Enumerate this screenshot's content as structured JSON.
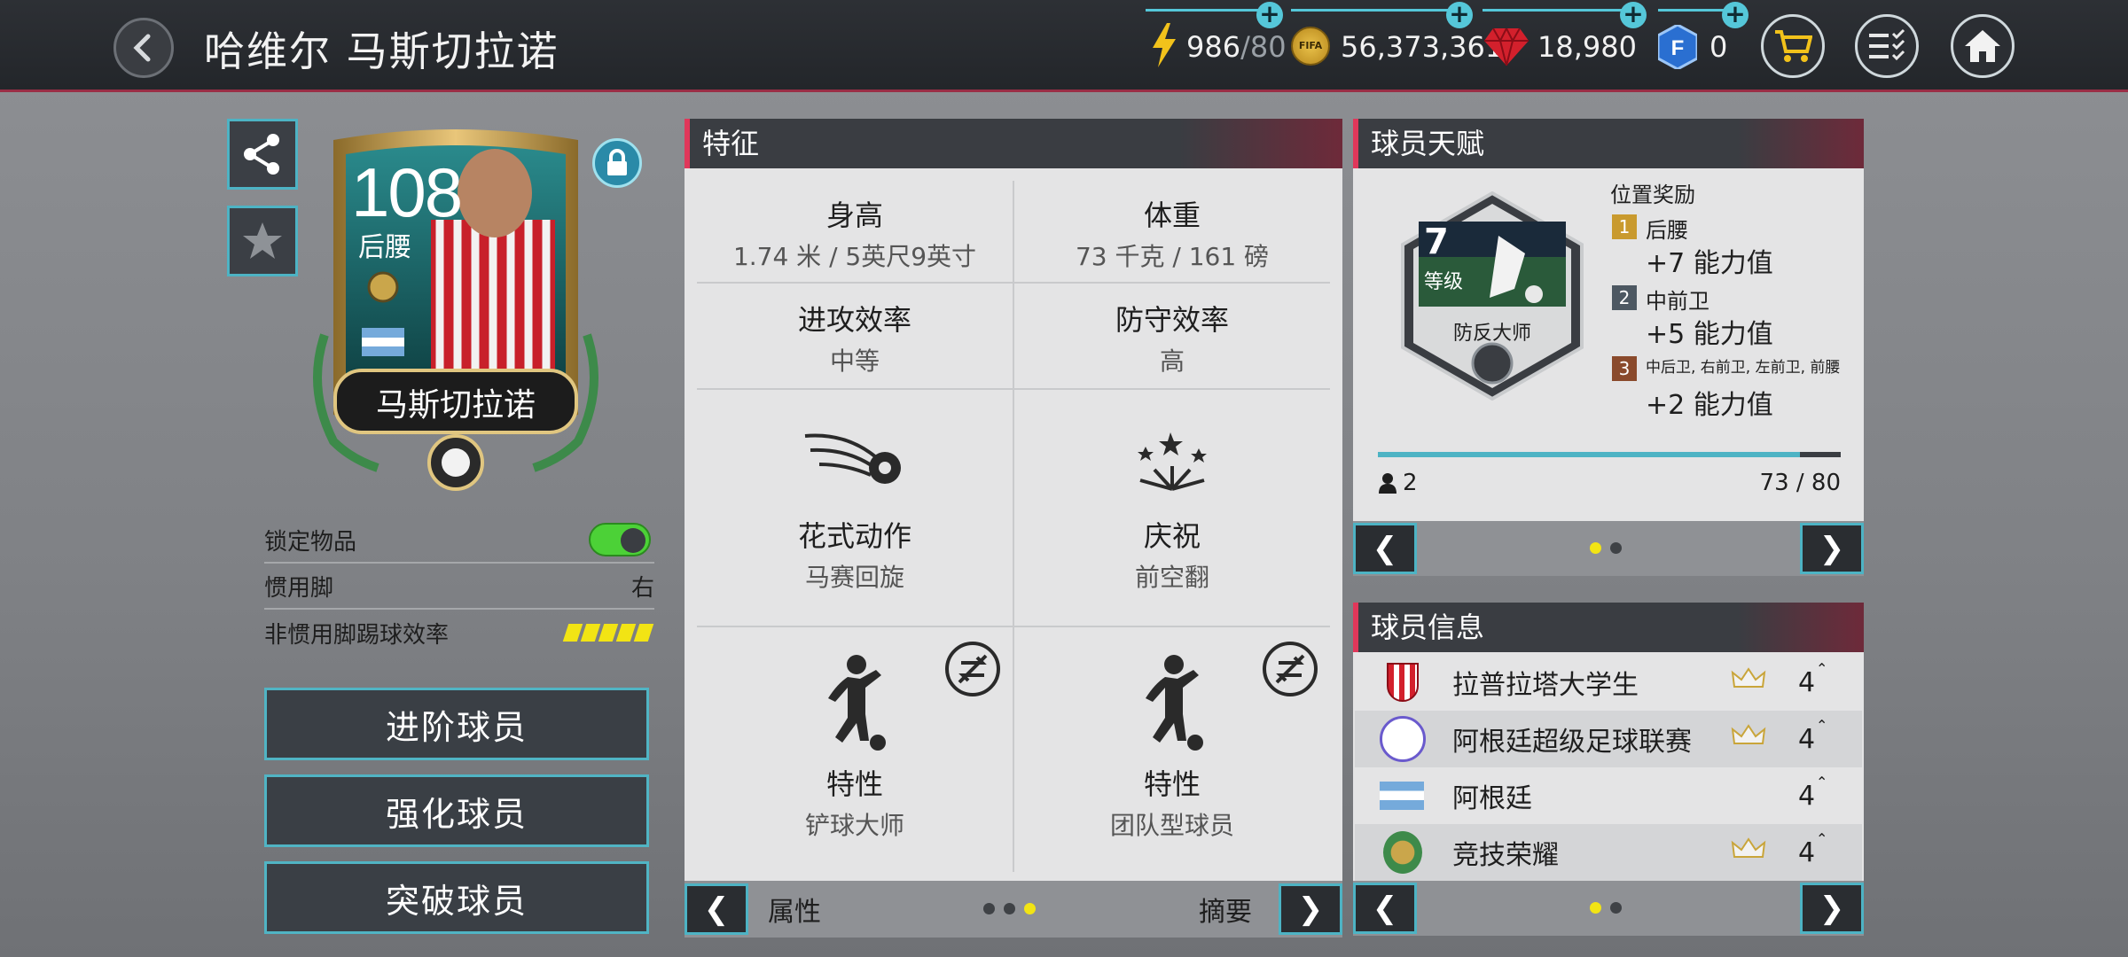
{
  "header": {
    "title": "哈维尔 马斯切拉诺",
    "energy": {
      "value": "986",
      "max": "/80"
    },
    "coins": "56,373,361",
    "gems": "18,980",
    "fifa_points": "0",
    "coin_label": "FIFA"
  },
  "card": {
    "rating": "108",
    "position": "后腰",
    "name": "马斯切拉诺"
  },
  "left_info": {
    "lock_label": "锁定物品",
    "lock_on": true,
    "preferred_foot_label": "惯用脚",
    "preferred_foot_value": "右",
    "weak_foot_label": "非惯用脚踢球效率",
    "weak_foot_stars": 5
  },
  "buttons": {
    "advance": "进阶球员",
    "train": "强化球员",
    "breakthrough": "突破球员"
  },
  "traits_panel": {
    "title": "特征",
    "height_label": "身高",
    "height_value": "1.74 米 / 5英尺9英寸",
    "weight_label": "体重",
    "weight_value": "73 千克 / 161 磅",
    "att_rate_label": "进攻效率",
    "att_rate_value": "中等",
    "def_rate_label": "防守效率",
    "def_rate_value": "高",
    "skill_label": "花式动作",
    "skill_value": "马赛回旋",
    "celebration_label": "庆祝",
    "celebration_value": "前空翻",
    "trait1_label": "特性",
    "trait1_value": "铲球大师",
    "trait2_label": "特性",
    "trait2_value": "团队型球员",
    "nav_left": "属性",
    "nav_right": "摘要",
    "page_index": 2,
    "page_count": 3
  },
  "skill_panel": {
    "title": "球员天赋",
    "level": "7",
    "level_label": "等级",
    "skill_name": "防反大师",
    "bonus_title": "位置奖励",
    "bonuses": [
      {
        "rank": "1",
        "pos": "后腰",
        "value": "+7 能力值",
        "color": "#c99a2e"
      },
      {
        "rank": "2",
        "pos": "中前卫",
        "value": "+5 能力值",
        "color": "#4d5862"
      },
      {
        "rank": "3",
        "pos": "中后卫, 右前卫, 左前卫, 前腰",
        "value": "+2 能力值",
        "color": "#8a4a2c"
      }
    ],
    "points": "2",
    "progress": "73 / 80",
    "progress_fraction": 0.9125,
    "page_index": 0,
    "page_count": 2
  },
  "player_info": {
    "title": "球员信息",
    "rows": [
      {
        "name": "拉普拉塔大学生",
        "value": "4",
        "crown": true
      },
      {
        "name": "阿根廷超级足球联赛",
        "value": "4",
        "crown": true
      },
      {
        "name": "阿根廷",
        "value": "4",
        "crown": false
      },
      {
        "name": "竞技荣耀",
        "value": "4",
        "crown": true
      }
    ],
    "page_index": 0,
    "page_count": 2
  },
  "colors": {
    "accent": "#4db3c4",
    "header_accent": "#e0375a",
    "toggle": "#4cd137",
    "dot_active": "#f2e414"
  }
}
